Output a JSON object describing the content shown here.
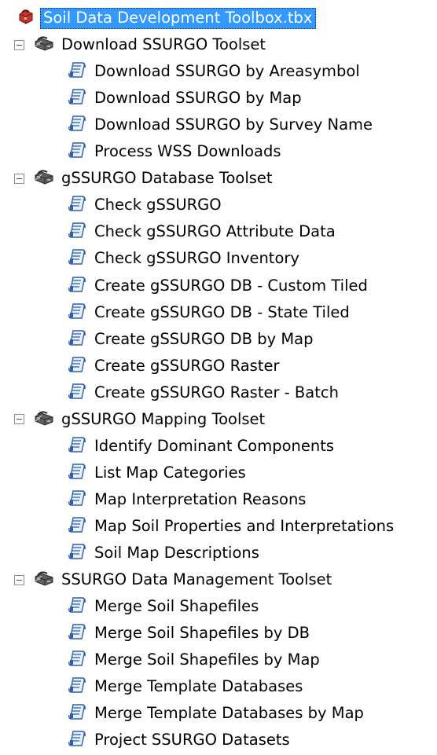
{
  "toolbox": {
    "name": "Soil Data Development Toolbox.tbx",
    "icon": "toolbox-icon"
  },
  "toolsets": [
    {
      "name": "Download SSURGO Toolset",
      "icon": "toolset-icon",
      "expanded": true,
      "tools": [
        "Download SSURGO by Areasymbol",
        "Download SSURGO by Map",
        "Download SSURGO by Survey Name",
        "Process WSS Downloads"
      ]
    },
    {
      "name": "gSSURGO Database Toolset",
      "icon": "toolset-icon",
      "expanded": true,
      "tools": [
        "Check gSSURGO",
        "Check gSSURGO Attribute Data",
        "Check gSSURGO Inventory",
        "Create gSSURGO DB - Custom Tiled",
        "Create gSSURGO DB - State Tiled",
        "Create gSSURGO DB by Map",
        "Create gSSURGO Raster",
        "Create gSSURGO Raster - Batch"
      ]
    },
    {
      "name": "gSSURGO Mapping Toolset",
      "icon": "toolset-icon",
      "expanded": true,
      "tools": [
        "Identify Dominant Components",
        "List Map Categories",
        "Map Interpretation Reasons",
        "Map Soil Properties and Interpretations",
        "Soil Map Descriptions"
      ]
    },
    {
      "name": "SSURGO Data Management Toolset",
      "icon": "toolset-icon",
      "expanded": true,
      "tools": [
        "Merge Soil Shapefiles",
        "Merge Soil Shapefiles by DB",
        "Merge Soil Shapefiles by Map",
        "Merge Template Databases",
        "Merge Template Databases by Map",
        "Project SSURGO Datasets"
      ]
    }
  ],
  "colors": {
    "selection_background": "#3399ff",
    "selection_text": "#ffffff",
    "text": "#000000"
  },
  "icons": {
    "expander": "collapse-box-icon",
    "tool": "script-tool-icon"
  }
}
